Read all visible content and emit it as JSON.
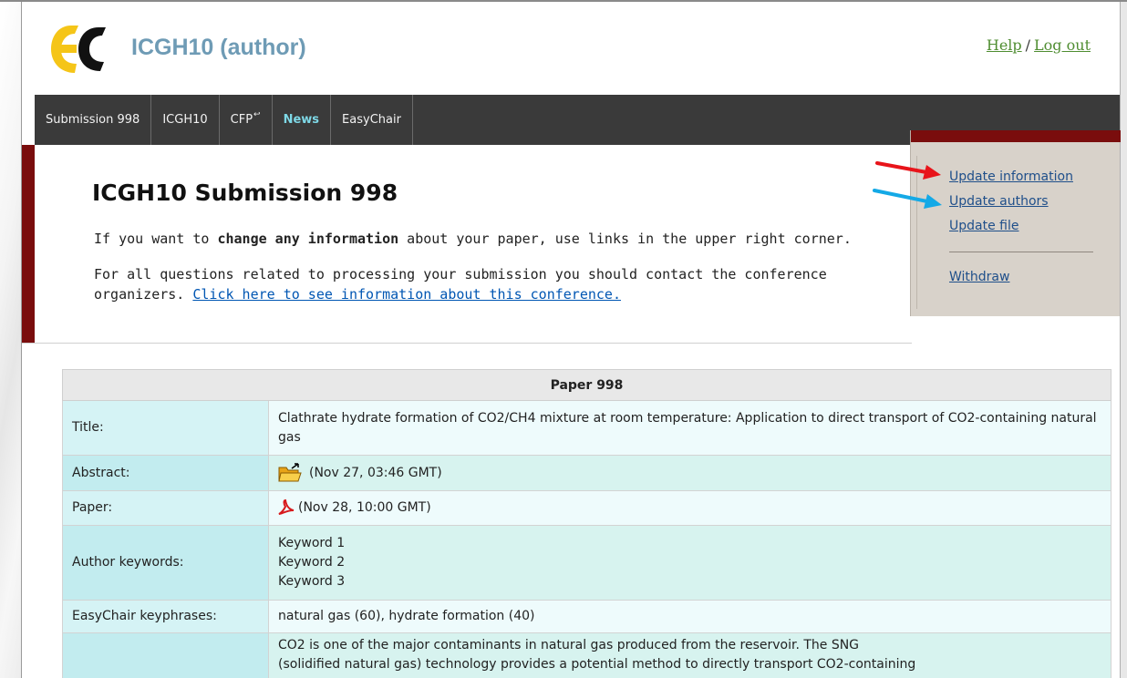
{
  "header": {
    "app_title": "ICGH10 (author)",
    "help_label": "Help",
    "separator": "/",
    "logout_label": "Log out"
  },
  "nav": {
    "tabs": [
      {
        "label": "Submission 998"
      },
      {
        "label": "ICGH10"
      },
      {
        "label": "CFP"
      },
      {
        "label": "News"
      },
      {
        "label": "EasyChair"
      }
    ]
  },
  "main": {
    "heading": "ICGH10 Submission 998",
    "para1_before": "If you want to ",
    "para1_bold": "change any information",
    "para1_after": " about your paper, use links in the upper right corner.",
    "para2_text": "For all questions related to processing your submission you should contact the conference organizers. ",
    "para2_link": "Click here to see information about this conference."
  },
  "sidebar": {
    "update_information": "Update information",
    "update_authors": "Update authors",
    "update_file": "Update file",
    "withdraw": "Withdraw"
  },
  "annotations": {
    "red_arrow_color": "#e8141a",
    "blue_arrow_color": "#14a9e6"
  },
  "table": {
    "header": "Paper 998",
    "title_label": "Title:",
    "title_value": "Clathrate hydrate formation of CO2/CH4 mixture at room temperature: Application to direct transport of CO2-containing natural gas",
    "abstract_label": "Abstract:",
    "abstract_icon": "folder-icon",
    "abstract_timestamp": "(Nov 27, 03:46 GMT)",
    "paper_label": "Paper:",
    "paper_icon": "pdf-icon",
    "paper_timestamp": "(Nov 28, 10:00 GMT)",
    "keywords_label": "Author keywords:",
    "keywords": [
      "Keyword 1",
      "Keyword 2",
      "Keyword 3"
    ],
    "keyphrases_label": "EasyChair keyphrases:",
    "keyphrases_value": "natural gas (60), hydrate formation (40)",
    "abstract_text_line1": "CO2 is one of the major contaminants in natural gas produced from the reservoir. The SNG",
    "abstract_text_line2": "(solidified natural gas) technology provides a potential method to directly transport CO2-containing"
  }
}
